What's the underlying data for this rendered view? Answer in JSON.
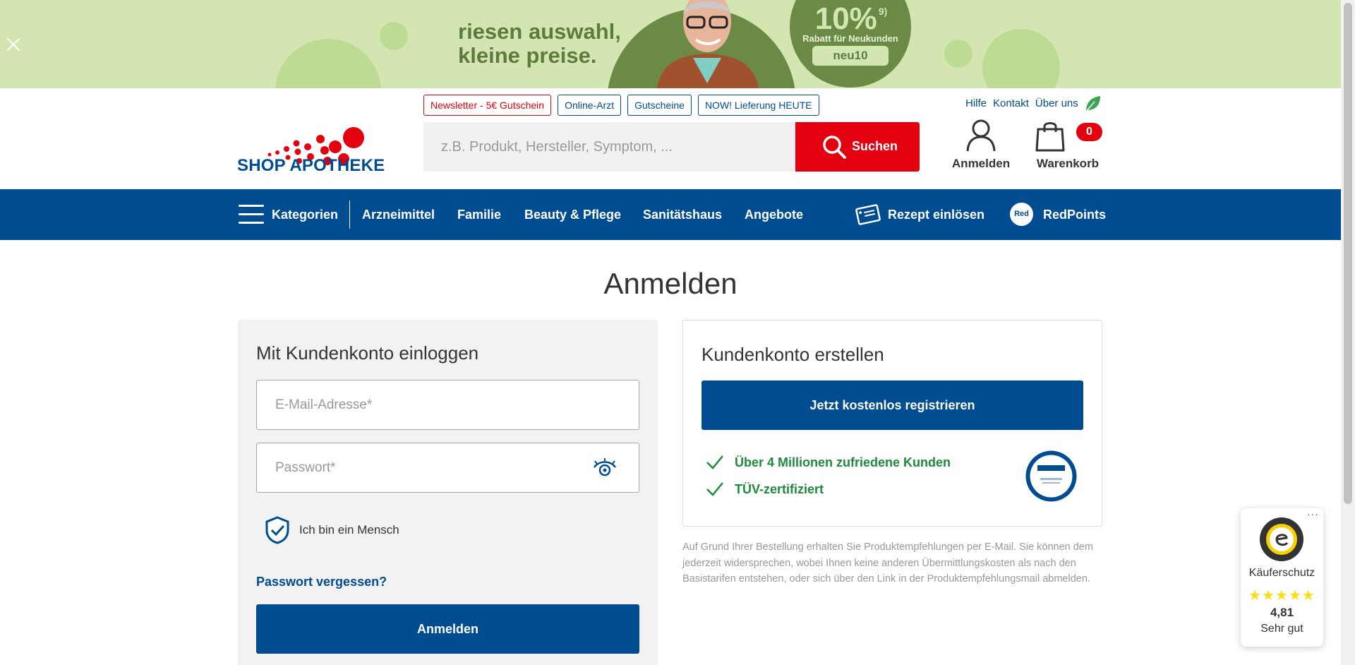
{
  "banner": {
    "slogan_line1": "riesen auswahl,",
    "slogan_line2": "kleine preise.",
    "discount_value": "10%",
    "discount_footnote": "9)",
    "discount_text": "Rabatt für Neukunden",
    "discount_code": "neu10"
  },
  "header": {
    "logo_text": "SHOP APOTHEKE",
    "chips": [
      "Newsletter - 5€ Gutschein",
      "Online-Arzt",
      "Gutscheine",
      "NOW! Lieferung HEUTE"
    ],
    "search_placeholder": "z.B. Produkt, Hersteller, Symptom, ...",
    "search_button": "Suchen",
    "top_links": [
      "Hilfe",
      "Kontakt",
      "Über uns"
    ],
    "account_label": "Anmelden",
    "cart_label": "Warenkorb",
    "cart_count": "0"
  },
  "nav": {
    "categories": "Kategorien",
    "items": [
      "Arzneimittel",
      "Familie",
      "Beauty & Pflege",
      "Sanitätshaus",
      "Angebote"
    ],
    "prescription": "Rezept einlösen",
    "redpoints_badge": "Red",
    "redpoints": "RedPoints"
  },
  "main": {
    "title": "Anmelden",
    "login": {
      "title": "Mit Kundenkonto einloggen",
      "email_placeholder": "E-Mail-Adresse*",
      "password_placeholder": "Passwort*",
      "captcha_text": "Ich bin ein Mensch",
      "forgot": "Passwort vergessen?",
      "submit": "Anmelden"
    },
    "register": {
      "title": "Kundenkonto erstellen",
      "button": "Jetzt kostenlos registrieren",
      "benefits": [
        "Über 4 Millionen zufriedene Kunden",
        "TÜV-zertifiziert"
      ]
    },
    "disclaimer": "Auf Grund Ihrer Bestellung erhalten Sie Produktempfehlungen per E-Mail. Sie können dem jederzeit widersprechen, wobei Ihnen keine anderen Übermittlungskosten als nach den Basistarifen entstehen, oder sich über den Link in der Produktempfehlungsmail abmelden."
  },
  "trusted_shops": {
    "label": "Käuferschutz",
    "stars": "★★★★★",
    "score": "4,81",
    "rating": "Sehr gut"
  },
  "colors": {
    "brand_blue": "#004c91",
    "brand_red": "#e3000f",
    "banner_green": "#d3e6b1",
    "success_green": "#1d8a3c"
  },
  "icons": [
    "close-icon",
    "search-icon",
    "leaf-icon",
    "user-icon",
    "bag-icon",
    "hamburger-icon",
    "prescription-icon",
    "eye-icon",
    "shield-check-icon",
    "checkmark-icon"
  ]
}
